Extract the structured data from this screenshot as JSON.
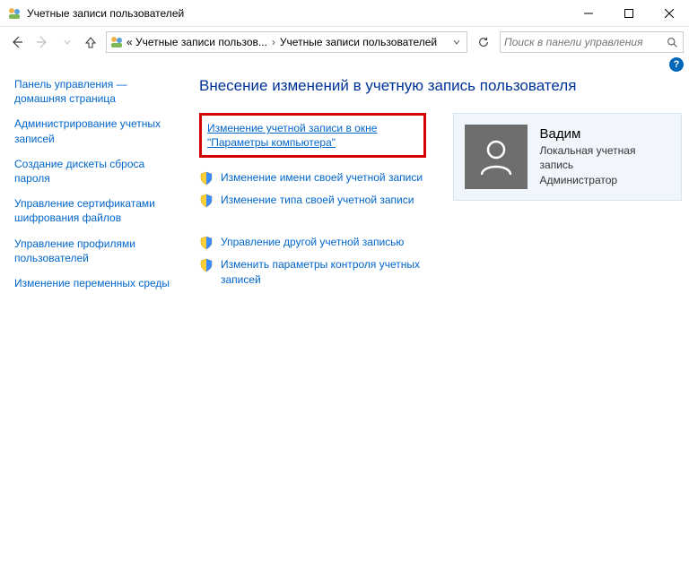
{
  "window": {
    "title": "Учетные записи пользователей"
  },
  "breadcrumb": {
    "seg1": "« Учетные записи пользов...",
    "seg2": "Учетные записи пользователей"
  },
  "search": {
    "placeholder": "Поиск в панели управления"
  },
  "sidebar": {
    "items": [
      "Панель управления — домашняя страница",
      "Администрирование учетных записей",
      "Создание дискеты сброса пароля",
      "Управление сертификатами шифрования файлов",
      "Управление профилями пользователей",
      "Изменение переменных среды"
    ]
  },
  "main": {
    "title": "Внесение изменений в учетную запись пользователя",
    "tasks": {
      "t0": "Изменение учетной записи в окне \"Параметры компьютера\"",
      "t1": "Изменение имени своей учетной записи",
      "t2": "Изменение типа своей учетной записи",
      "t3": "Управление другой учетной записью",
      "t4": "Изменить параметры контроля учетных записей"
    }
  },
  "user": {
    "name": "Вадим",
    "type": "Локальная учетная запись",
    "role": "Администратор"
  }
}
